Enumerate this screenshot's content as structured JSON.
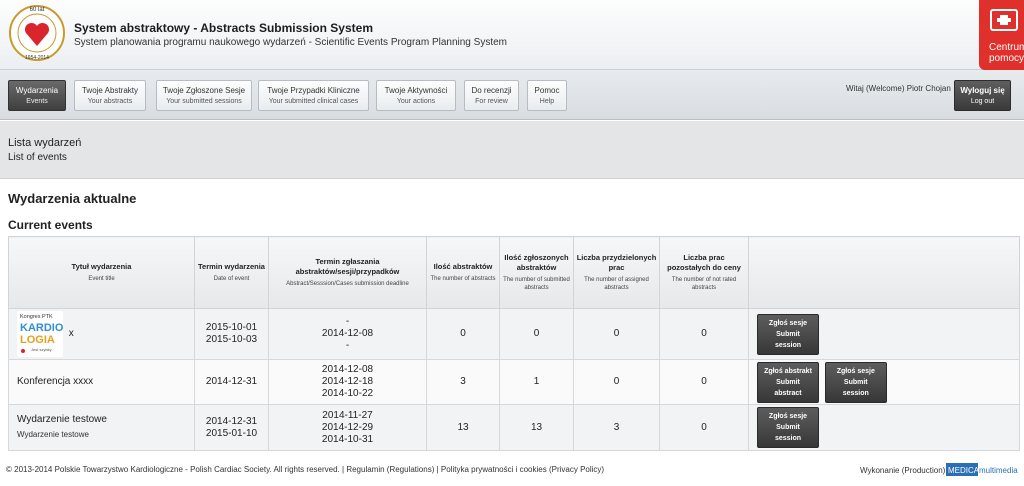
{
  "header": {
    "title": "System abstraktowy - Abstracts Submission System",
    "subtitle": "System planowania programu naukowego wydarzeń - Scientific Events Program Planning System",
    "logo": {
      "top_text": "60 lat",
      "years": "1954-2014",
      "ring_text": "KARDIOLOGICZNE TOWARZYSTWO POLSKIE"
    },
    "help": {
      "label": "Centrum\npomocy"
    }
  },
  "nav": {
    "items": [
      {
        "label": "Wydarzenia",
        "sub": "Events",
        "active": true
      },
      {
        "label": "Twoje Abstrakty",
        "sub": "Your abstracts"
      },
      {
        "label": "Twoje Zgłoszone Sesje",
        "sub": "Your submitted sessions"
      },
      {
        "label": "Twoje Przypadki Kliniczne",
        "sub": "Your submitted clinical cases"
      },
      {
        "label": "Twoje Aktywności",
        "sub": "Your actions"
      },
      {
        "label": "Do recenzji",
        "sub": "For review"
      },
      {
        "label": "Pomoc",
        "sub": "Help"
      }
    ],
    "welcome": "Witaj (Welcome) Piotr Chojan",
    "logout": {
      "label": "Wyloguj się",
      "sub": "Log out"
    }
  },
  "page": {
    "title": "Lista wydarzeń",
    "subtitle": "List of events",
    "section_pl": "Wydarzenia aktualne",
    "section_en": "Current events"
  },
  "table": {
    "headers": [
      {
        "label": "Tytuł wydarzenia",
        "sub": "Event title"
      },
      {
        "label": "Termin wydarzenia",
        "sub": "Date of event"
      },
      {
        "label": "Termin zgłaszania abstraktów/sesji/przypadków",
        "sub": "Abstract/Sesssion/Cases submission deadline"
      },
      {
        "label": "Ilość abstraktów",
        "sub": "The number of abstracts"
      },
      {
        "label": "Ilość zgłoszonych abstraktów",
        "sub": "The number of submitted abstracts"
      },
      {
        "label": "Liczba przydzielonych prac",
        "sub": "The number of assigned abstracts"
      },
      {
        "label": "Liczba prac pozostałych do ceny",
        "sub": "The number of not rated abstracts"
      },
      {
        "label": "",
        "sub": ""
      }
    ],
    "rows": [
      {
        "title": "x",
        "logo": {
          "line1": "Kongres PTK",
          "line2": "KARDIO",
          "line3": "LOGIA",
          "line4": "Jest szybky"
        },
        "dates": [
          "2015-10-01",
          "2015-10-03"
        ],
        "deadlines": [
          "-",
          "2014-12-08",
          "-"
        ],
        "abstracts": "0",
        "submitted": "0",
        "assigned": "0",
        "not_rated": "0",
        "buttons": [
          {
            "label": "Zgłoś sesje",
            "sub": "Submit session"
          }
        ]
      },
      {
        "title": "Konferencja xxxx",
        "dates": [
          "2014-12-31"
        ],
        "deadlines": [
          "2014-12-08",
          "2014-12-18",
          "2014-10-22"
        ],
        "abstracts": "3",
        "submitted": "1",
        "assigned": "0",
        "not_rated": "0",
        "buttons": [
          {
            "label": "Zgłoś abstrakt",
            "sub": "Submit abstract"
          },
          {
            "label": "Zgłoś sesje",
            "sub": "Submit session"
          }
        ]
      },
      {
        "title": "Wydarzenie testowe",
        "subtitle": "Wydarzenie testowe",
        "dates": [
          "2014-12-31",
          "2015-01-10"
        ],
        "deadlines": [
          "2014-11-27",
          "2014-12-29",
          "2014-10-31"
        ],
        "abstracts": "13",
        "submitted": "13",
        "assigned": "3",
        "not_rated": "0",
        "buttons": [
          {
            "label": "Zgłoś sesje",
            "sub": "Submit session"
          }
        ]
      }
    ]
  },
  "footer": {
    "copyright": "© 2013-2014 Polskie Towarzystwo Kardiologiczne - Polish Cardiac Society. All rights reserved.",
    "separator": "|",
    "regulations": "Regulamin (Regulations)",
    "privacy": "Polityka prywatności i cookies (Privacy Policy)",
    "production": "Wykonanie (Production):",
    "production_logo_a": "MEDICAL",
    "production_logo_b": "multimedia"
  },
  "colors": {
    "accent_red": "#e0302b",
    "active_nav": "#4a4a4a",
    "heart": "#d8262c"
  }
}
